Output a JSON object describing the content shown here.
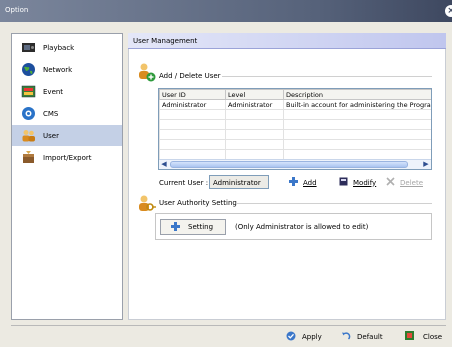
{
  "window": {
    "title": "Option"
  },
  "sidebar": {
    "items": [
      {
        "label": "Playback",
        "icon": "film-icon"
      },
      {
        "label": "Network",
        "icon": "globe-icon"
      },
      {
        "label": "Event",
        "icon": "event-icon"
      },
      {
        "label": "CMS",
        "icon": "cms-icon"
      },
      {
        "label": "User",
        "icon": "users-icon",
        "selected": true
      },
      {
        "label": "Import/Export",
        "icon": "import-export-icon"
      }
    ]
  },
  "main": {
    "section_title": "User Management",
    "add_delete_group": {
      "title": "Add / Delete User",
      "columns": [
        "User ID",
        "Level",
        "Description"
      ],
      "rows": [
        [
          "Administrator",
          "Administrator",
          "Built-in account for administering the Program"
        ]
      ],
      "current_user_label": "Current User :",
      "current_user_value": "Administrator",
      "buttons": {
        "add": "Add",
        "modify": "Modify",
        "delete": "Delete"
      }
    },
    "authority_group": {
      "title": "User Authority Setting",
      "setting_button": "Setting",
      "note": "(Only Administrator is allowed to edit)"
    }
  },
  "footer": {
    "apply": "Apply",
    "default": "Default",
    "close": "Close"
  },
  "colors": {
    "titlebar": "#56627a",
    "selected_item": "#c4d0e6",
    "section_header": "#c0c6ee",
    "disabled_text": "#a5a5a5"
  }
}
